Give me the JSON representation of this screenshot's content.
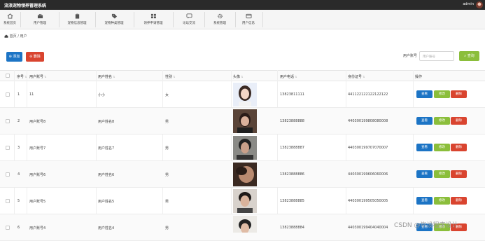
{
  "header": {
    "app_title": "流浪宠物领养管理系统",
    "user": "admin"
  },
  "nav": [
    {
      "label": "系统首页",
      "icon": "home-icon"
    },
    {
      "label": "用户管理",
      "icon": "briefcase-icon"
    },
    {
      "label": "宠物信息管理",
      "icon": "clipboard-icon"
    },
    {
      "label": "宠物种类管理",
      "icon": "tag-icon"
    },
    {
      "label": "领养申请管理",
      "icon": "grid-icon"
    },
    {
      "label": "论坛交流",
      "icon": "chat-icon"
    },
    {
      "label": "系统管理",
      "icon": "gear-icon"
    },
    {
      "label": "用户信息",
      "icon": "id-card-icon"
    }
  ],
  "breadcrumb": {
    "home": "首页",
    "sep": "/",
    "current": "用户"
  },
  "toolbar": {
    "add_label": "添加",
    "delete_label": "删除"
  },
  "search": {
    "label": "用户账号",
    "placeholder": "用户账号",
    "button": "查询"
  },
  "table": {
    "headers": [
      "序号",
      "用户账号",
      "用户姓名",
      "性别",
      "头像",
      "用户电话",
      "身份证号",
      "操作"
    ],
    "actions": {
      "view": "查看",
      "edit": "修改",
      "delete": "删除"
    },
    "rows": [
      {
        "no": "1",
        "account": "11",
        "name": "小小",
        "gender": "女",
        "phone": "13823811111",
        "id_card": "441122122122122122"
      },
      {
        "no": "2",
        "account": "用户账号8",
        "name": "用户姓名8",
        "gender": "男",
        "phone": "13823888888",
        "id_card": "440300199808080008"
      },
      {
        "no": "3",
        "account": "用户账号7",
        "name": "用户姓名7",
        "gender": "男",
        "phone": "13823888887",
        "id_card": "440300199707070007"
      },
      {
        "no": "4",
        "account": "用户账号6",
        "name": "用户姓名6",
        "gender": "男",
        "phone": "13823888886",
        "id_card": "440300199606060006"
      },
      {
        "no": "5",
        "account": "用户账号5",
        "name": "用户姓名5",
        "gender": "男",
        "phone": "13823888885",
        "id_card": "440300199505050005"
      },
      {
        "no": "6",
        "account": "用户账号4",
        "name": "用户姓名4",
        "gender": "男",
        "phone": "13823888884",
        "id_card": "440300199404040004"
      }
    ]
  },
  "watermark": "CSDN @毕设程序设计"
}
